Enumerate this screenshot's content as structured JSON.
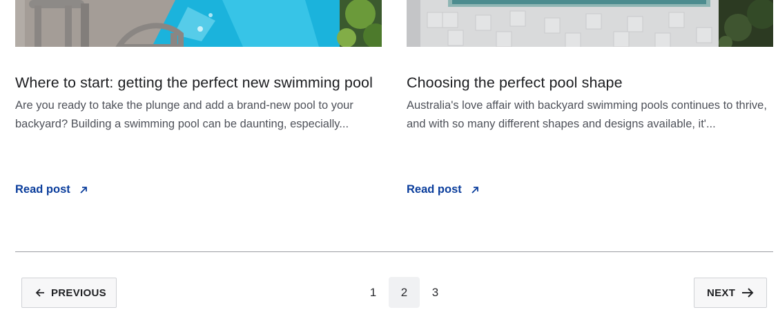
{
  "posts": [
    {
      "title": "Where to start: getting the perfect new swimming pool",
      "excerpt": "Are you ready to take the plunge and add a brand-new pool to your backyard? Building a swimming pool can be daunting, especially...",
      "link_label": "Read post"
    },
    {
      "title": "Choosing the perfect pool shape",
      "excerpt": "Australia's love affair with backyard swimming pools continues to thrive, and with so many different shapes and designs available, it'...",
      "link_label": "Read post"
    }
  ],
  "pagination": {
    "previous_label": "PREVIOUS",
    "next_label": "NEXT",
    "pages": [
      "1",
      "2",
      "3"
    ],
    "current_page": "2"
  },
  "colors": {
    "link": "#0a3d9c",
    "divider": "#9a9ca1",
    "current_page_bg": "#f0f1f3"
  },
  "icons": {
    "read_link": "arrow-up-right-icon",
    "previous": "arrow-left-icon",
    "next": "arrow-right-icon"
  }
}
